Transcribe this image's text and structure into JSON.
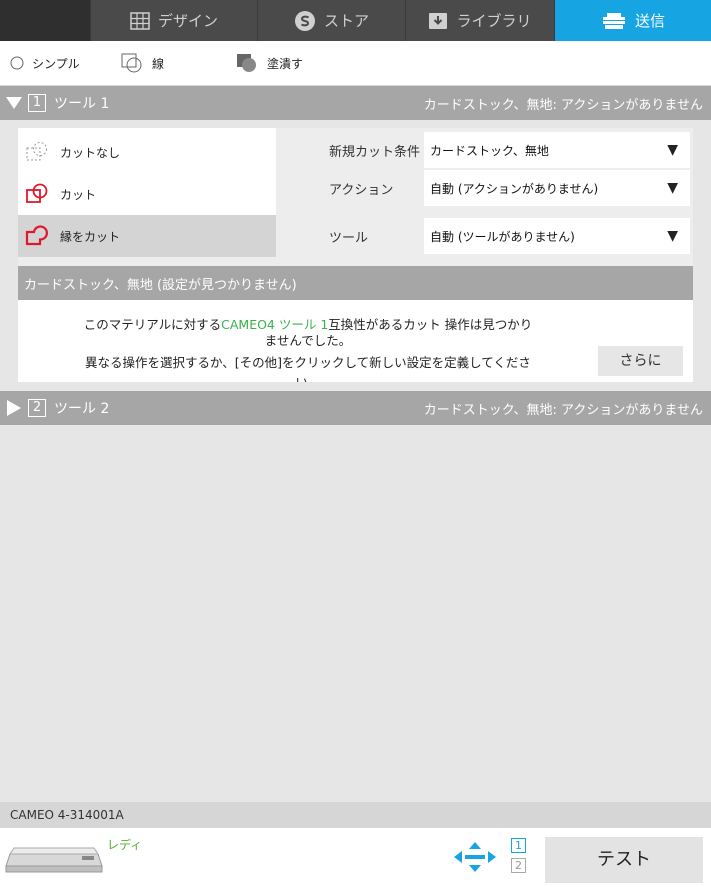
{
  "nav": {
    "tabs": [
      {
        "label": "デザイン",
        "icon": "grid-icon"
      },
      {
        "label": "ストア",
        "icon": "store-icon"
      },
      {
        "label": "ライブラリ",
        "icon": "library-icon"
      },
      {
        "label": "送信",
        "icon": "send-icon",
        "active": true
      }
    ]
  },
  "modes": {
    "simple": "シンプル",
    "line": "線",
    "fill": "塗潰す"
  },
  "tool1": {
    "number": "1",
    "label": "ツール 1",
    "summary": "カードストック、無地: アクションがありません",
    "cut_options": [
      "カットなし",
      "カット",
      "縁をカット"
    ],
    "selected_cut": "縁をカット",
    "props": [
      {
        "label": "新規カット条件",
        "value": "カードストック、無地"
      },
      {
        "label": "アクション",
        "value": "自動 (アクションがありません)"
      },
      {
        "label": "ツール",
        "value": "自動 (ツールがありません)"
      }
    ],
    "warning_title": "カードストック、無地 (設定が見つかりません)",
    "warning_line1_a": "このマテリアルに対する",
    "warning_line1_b": "CAMEO4 ツール 1",
    "warning_line1_c": "互換性があるカット 操作は見つかり",
    "warning_line2": "ませんでした。",
    "warning_line3": "異なる操作を選択するか、[その他]をクリックして新しい設定を定義してくださ",
    "warning_line4": "い。",
    "more_button": "さらに"
  },
  "tool2": {
    "number": "2",
    "label": "ツール 2",
    "summary": "カードストック、無地: アクションがありません"
  },
  "device": {
    "name": "CAMEO 4-314001A",
    "status": "レディ",
    "page1": "1",
    "page2": "2",
    "test_button": "テスト"
  },
  "colors": {
    "accent": "#16a5e2",
    "header_gray": "#a6a6a6",
    "cut_red": "#e0182d",
    "ready_green": "#4fb233"
  }
}
